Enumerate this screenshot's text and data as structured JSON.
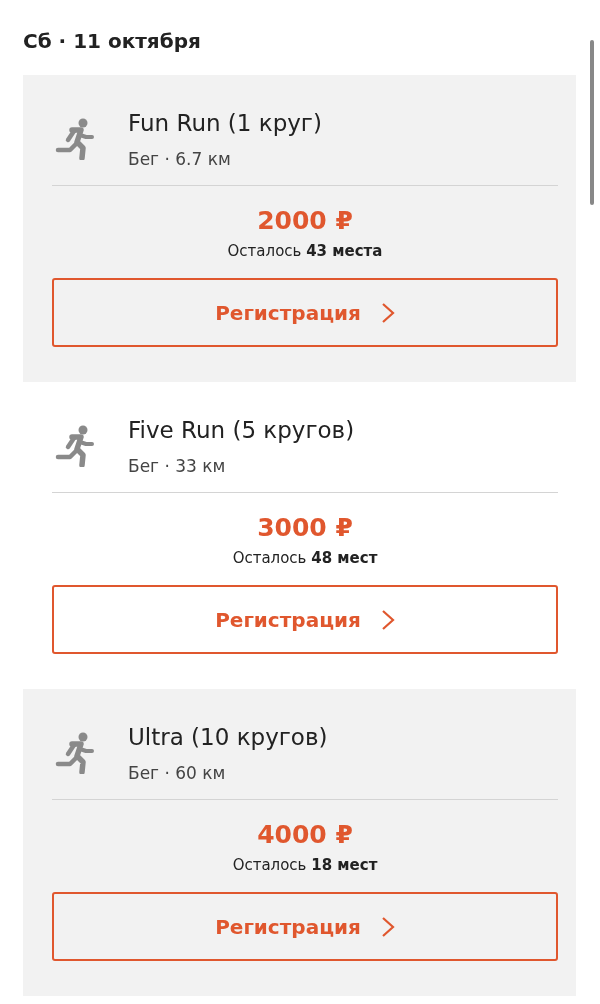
{
  "date_heading": "Сб · 11 октября",
  "events": [
    {
      "title": "Fun Run (1 круг)",
      "details": "Бег · 6.7 км",
      "price": "2000 ₽",
      "remaining": "Осталось **43 места**",
      "button": "Регистрация",
      "highlighted": true
    },
    {
      "title": "Five Run (5 кругов)",
      "details": "Бег · 33 км",
      "price": "3000 ₽",
      "remaining": "Осталось **48 мест**",
      "button": "Регистрация",
      "highlighted": false
    },
    {
      "title": "Ultra (10 кругов)",
      "details": "Бег · 60 км",
      "price": "4000 ₽",
      "remaining": "Осталось **18 мест**",
      "button": "Регистрация",
      "highlighted": true
    }
  ]
}
